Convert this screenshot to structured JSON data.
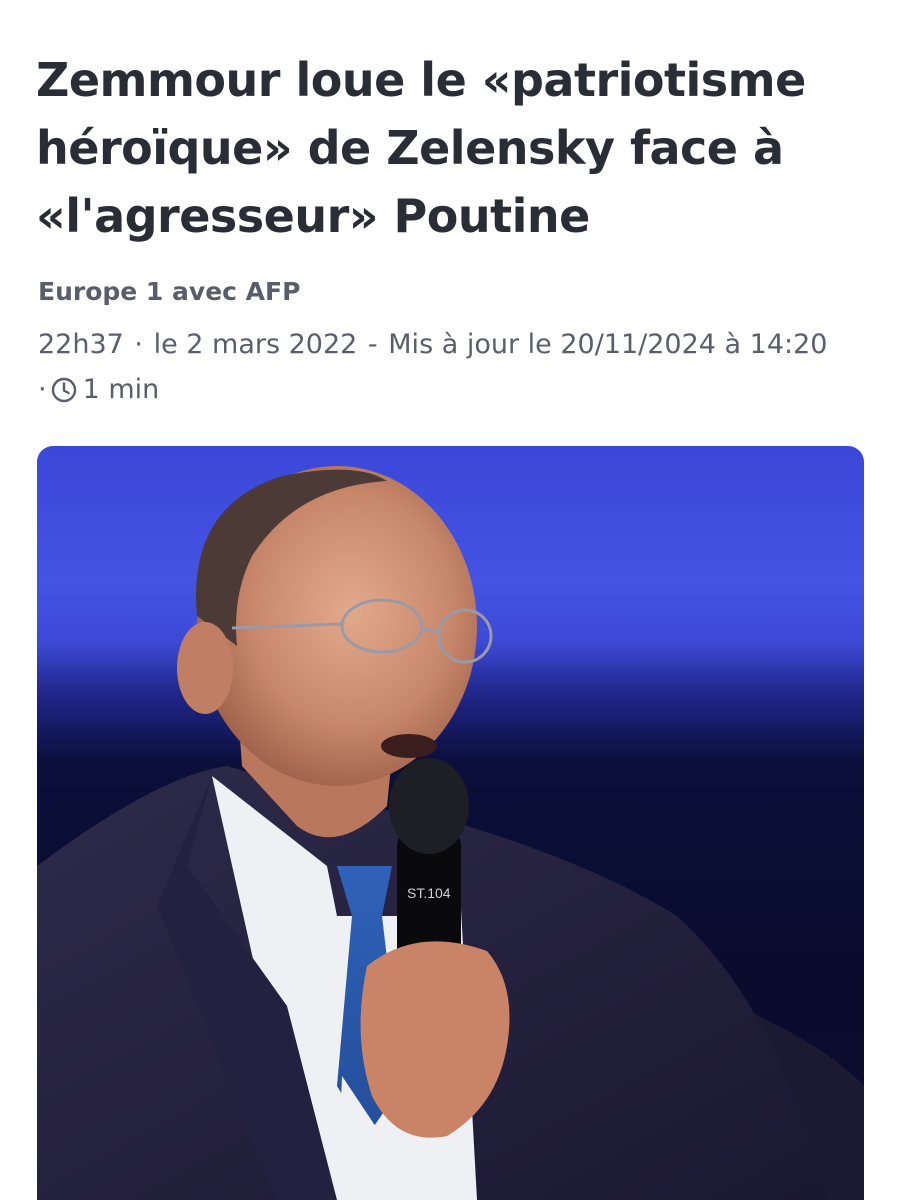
{
  "article": {
    "headline": "Zemmour loue le «patriotisme héroïque» de Zelensky face à «l'agresseur» Poutine",
    "source": "Europe 1 avec AFP",
    "time": "22h37",
    "date": "le 2 mars 2022",
    "updated": "Mis à jour le 20/11/2024 à 14:20",
    "reading_time": "1 min",
    "reading_icon": "clock-icon",
    "mic_label": "ST.104"
  },
  "colors": {
    "headline": "#2a2c36",
    "meta": "#5b5e6a",
    "photo_backdrop": "#3a47d8"
  }
}
